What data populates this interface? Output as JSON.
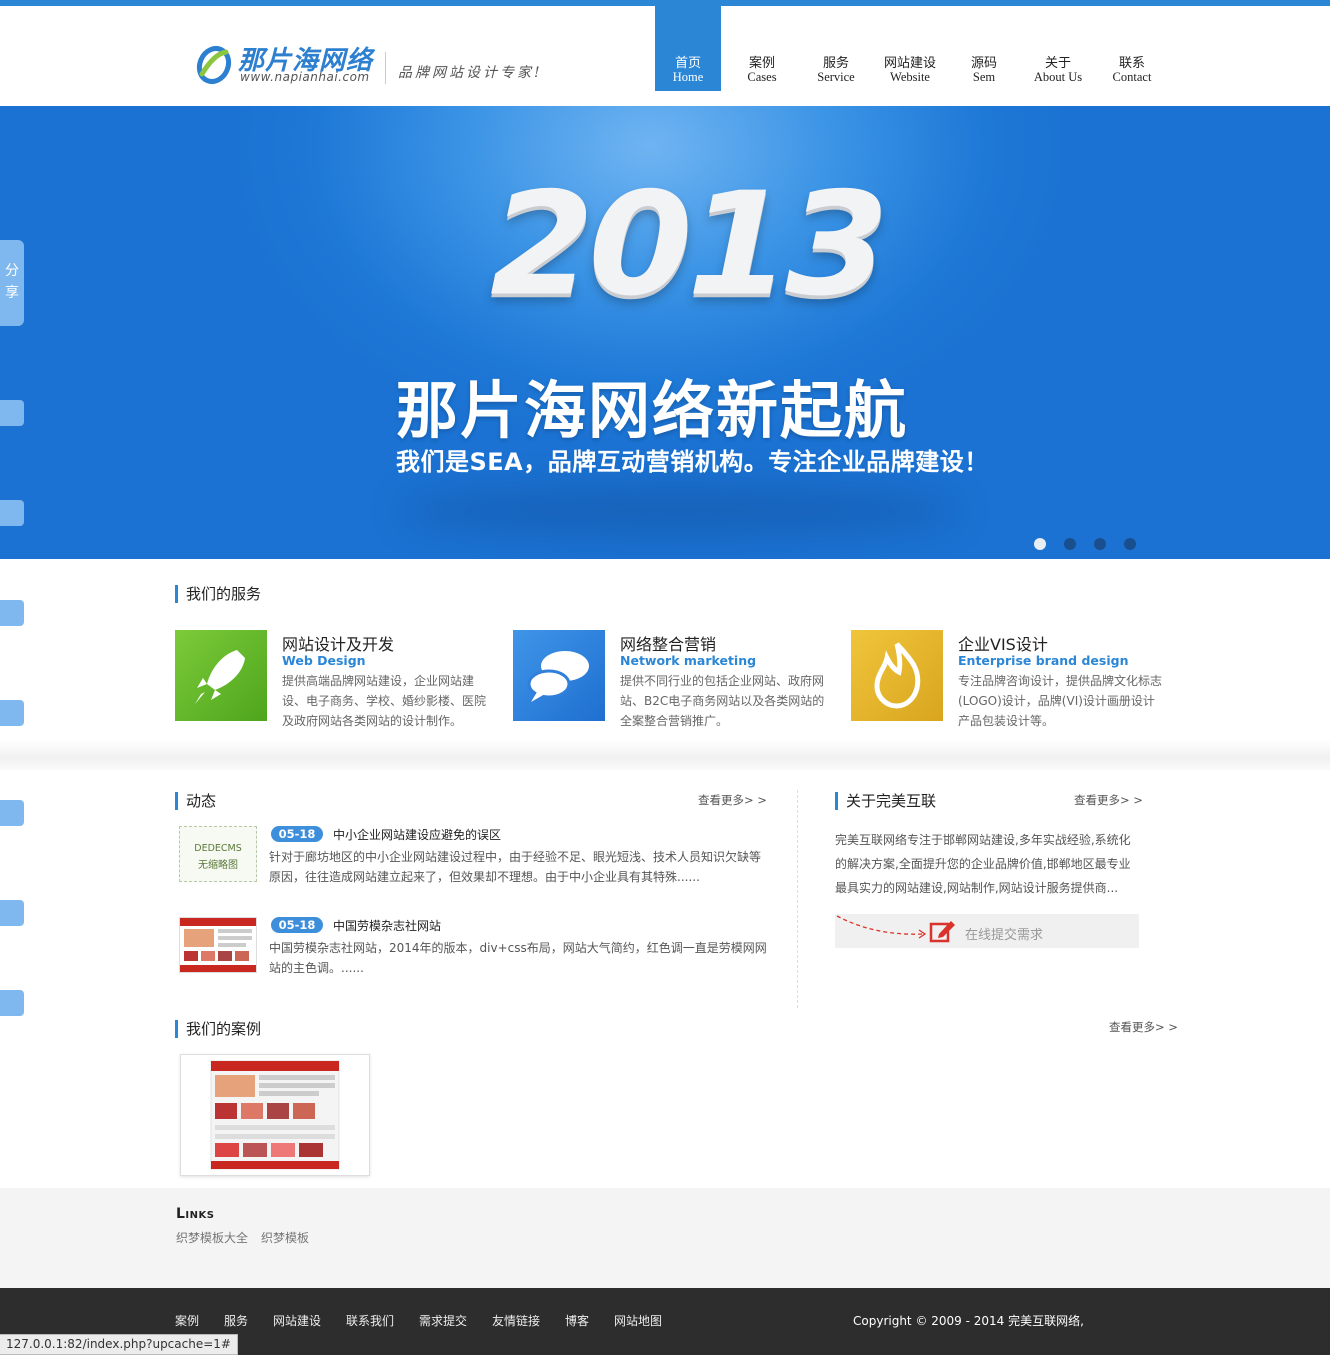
{
  "brand": {
    "name": "那片海网络",
    "domain": "www.napianhai.com",
    "slogan": "品牌网站设计专家!"
  },
  "nav": [
    {
      "cn": "首页",
      "en": "Home",
      "active": true
    },
    {
      "cn": "案例",
      "en": "Cases"
    },
    {
      "cn": "服务",
      "en": "Service"
    },
    {
      "cn": "网站建设",
      "en": "Website"
    },
    {
      "cn": "源码",
      "en": "Sem"
    },
    {
      "cn": "关于",
      "en": "About Us"
    },
    {
      "cn": "联系",
      "en": "Contact"
    }
  ],
  "share": {
    "label_1": "分",
    "label_2": "享"
  },
  "banner": {
    "year": "2013",
    "headline": "那片海网络新起航",
    "subline": "我们是SEA，品牌互动营销机构。专注企业品牌建设！",
    "dots_count": 4,
    "active_dot": 1
  },
  "services": {
    "title": "我们的服务",
    "items": [
      {
        "title": "网站设计及开发",
        "subtitle": "Web Design",
        "desc": "提供高端品牌网站建设，企业网站建设、电子商务、学校、婚纱影楼、医院及政府网站各类网站的设计制作。",
        "color": "#5fb52a",
        "icon": "rocket-icon"
      },
      {
        "title": "网络整合营销",
        "subtitle": "Network marketing",
        "desc": "提供不同行业的包括企业网站、政府网站、B2C电子商务网站以及各类网站的全案整合营销推广。",
        "color": "#2f7fdb",
        "icon": "chat-bubbles-icon"
      },
      {
        "title": "企业VIS设计",
        "subtitle": "Enterprise brand design",
        "desc": "专注品牌咨询设计，提供品牌文化标志(LOGO)设计，品牌(VI)设计画册设计产品包装设计等。",
        "color": "#e0b22c",
        "icon": "flame-icon"
      }
    ]
  },
  "news": {
    "title": "动态",
    "more": "查看更多> >",
    "items": [
      {
        "date": "05-18",
        "title": "中小企业网站建设应避免的误区",
        "desc": "针对于廊坊地区的中小企业网站建设过程中，由于经验不足、眼光短浅、技术人员知识欠缺等原因，往往造成网站建立起来了，但效果却不理想。由于中小企业具有其特殊......",
        "thumb_line1": "DEDECMS",
        "thumb_line2": "无缩略图"
      },
      {
        "date": "05-18",
        "title": "中国劳模杂志社网站",
        "desc": "中国劳模杂志社网站，2014年的版本，div+css布局，网站大气简约，红色调一直是劳模网网站的主色调。......"
      }
    ]
  },
  "about": {
    "title": "关于完美互联",
    "more": "查看更多> >",
    "text": "完美互联网络专注于邯郸网站建设,多年实战经验,系统化的解决方案,全面提升您的企业品牌价值,邯郸地区最专业最具实力的网站建设,网站制作,网站设计服务提供商...",
    "submit_label": "在线提交需求"
  },
  "cases": {
    "title": "我们的案例",
    "more": "查看更多> >"
  },
  "links": {
    "title": "Links",
    "items": [
      "织梦模板大全",
      "织梦模板"
    ]
  },
  "footer": {
    "links": [
      "案例",
      "服务",
      "网站建设",
      "联系我们",
      "需求提交",
      "友情链接",
      "博客",
      "网站地图"
    ],
    "copyright": "Copyright © 2009 - 2014 完美互联网络,"
  },
  "statusbar": {
    "url": "127.0.0.1:82/index.php?upcache=1#"
  },
  "colors": {
    "accent": "#2b86d6",
    "footer": "#2d2d2d"
  }
}
